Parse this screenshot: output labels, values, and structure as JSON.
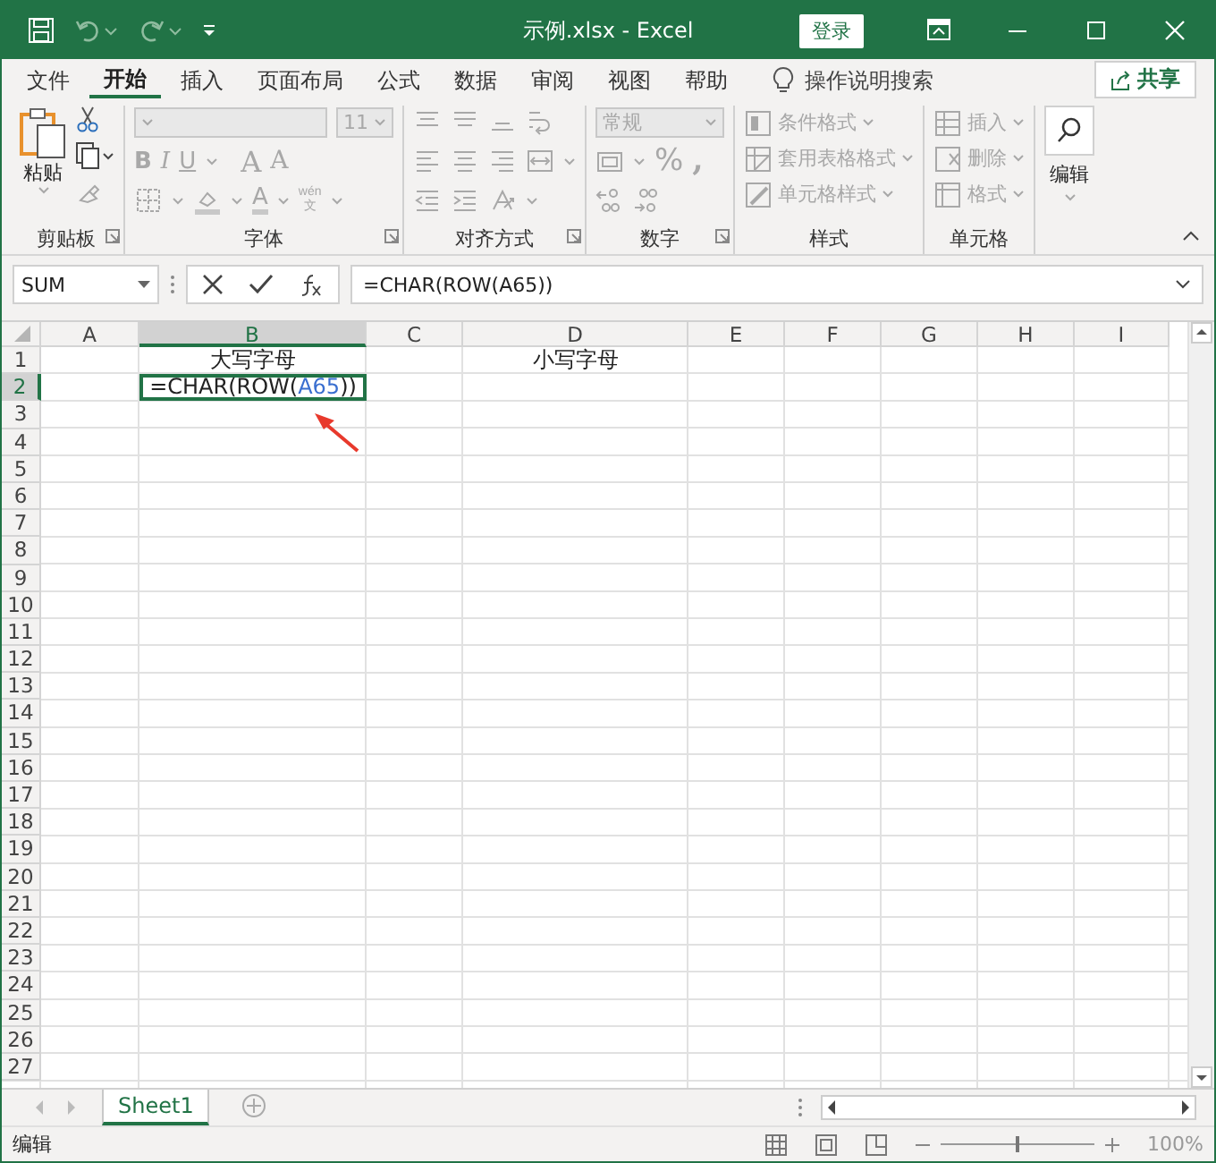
{
  "window": {
    "title": "示例.xlsx  -  Excel",
    "sign_in": "登录"
  },
  "menu_tabs": [
    {
      "label": "文件",
      "selected": false
    },
    {
      "label": "开始",
      "selected": true
    },
    {
      "label": "插入",
      "selected": false
    },
    {
      "label": "页面布局",
      "selected": false
    },
    {
      "label": "公式",
      "selected": false
    },
    {
      "label": "数据",
      "selected": false
    },
    {
      "label": "审阅",
      "selected": false
    },
    {
      "label": "视图",
      "selected": false
    },
    {
      "label": "帮助",
      "selected": false
    }
  ],
  "tell_me": "操作说明搜索",
  "share": "共享",
  "ribbon": {
    "groups": [
      {
        "kind": "clipboard",
        "label": "剪贴板",
        "disabled": false,
        "items": [
          "粘贴"
        ]
      },
      {
        "kind": "font",
        "label": "字体",
        "disabled": true,
        "items": [
          "11",
          "B",
          "I",
          "U",
          "A",
          "A",
          "A",
          "wén",
          "文"
        ]
      },
      {
        "kind": "alignment",
        "label": "对齐方式",
        "disabled": true
      },
      {
        "kind": "number",
        "label": "数字",
        "disabled": true,
        "items": [
          "常规",
          "%",
          ","
        ]
      },
      {
        "kind": "styles",
        "label": "样式",
        "disabled": true,
        "items": [
          "条件格式",
          "套用表格格式",
          "单元格样式"
        ]
      },
      {
        "kind": "cells",
        "label": "单元格",
        "disabled": true,
        "items": [
          "插入",
          "删除",
          "格式"
        ]
      },
      {
        "kind": "editing",
        "label": "编辑",
        "disabled": false
      }
    ]
  },
  "formula_bar": {
    "name_box": "SUM",
    "formula": "=CHAR(ROW(A65))"
  },
  "grid": {
    "columns": [
      {
        "label": "A",
        "selected": false
      },
      {
        "label": "B",
        "selected": true
      },
      {
        "label": "C",
        "selected": false
      },
      {
        "label": "D",
        "selected": false
      },
      {
        "label": "E",
        "selected": false
      },
      {
        "label": "F",
        "selected": false
      },
      {
        "label": "G",
        "selected": false
      },
      {
        "label": "H",
        "selected": false
      },
      {
        "label": "I",
        "selected": false
      }
    ],
    "rows": [
      {
        "label": "1",
        "selected": false,
        "cells": {
          "B": {
            "active": false,
            "segments": [
              {
                "text": "大写字母",
                "kind": "plain"
              }
            ]
          },
          "D": {
            "active": false,
            "segments": [
              {
                "text": "小写字母",
                "kind": "plain"
              }
            ]
          }
        }
      },
      {
        "label": "2",
        "selected": true,
        "cells": {
          "B": {
            "active": true,
            "segments": [
              {
                "text": "=CHAR(ROW(",
                "kind": "plain"
              },
              {
                "text": "A65",
                "kind": "reference"
              },
              {
                "text": "))",
                "kind": "plain"
              }
            ]
          }
        }
      },
      {
        "label": "3",
        "selected": false
      },
      {
        "label": "4",
        "selected": false
      },
      {
        "label": "5",
        "selected": false
      },
      {
        "label": "6",
        "selected": false
      },
      {
        "label": "7",
        "selected": false
      },
      {
        "label": "8",
        "selected": false
      },
      {
        "label": "9",
        "selected": false
      },
      {
        "label": "10",
        "selected": false
      },
      {
        "label": "11",
        "selected": false
      },
      {
        "label": "12",
        "selected": false
      },
      {
        "label": "13",
        "selected": false
      },
      {
        "label": "14",
        "selected": false
      },
      {
        "label": "15",
        "selected": false
      },
      {
        "label": "16",
        "selected": false
      },
      {
        "label": "17",
        "selected": false
      },
      {
        "label": "18",
        "selected": false
      },
      {
        "label": "19",
        "selected": false
      },
      {
        "label": "20",
        "selected": false
      },
      {
        "label": "21",
        "selected": false
      },
      {
        "label": "22",
        "selected": false
      },
      {
        "label": "23",
        "selected": false
      },
      {
        "label": "24",
        "selected": false
      },
      {
        "label": "25",
        "selected": false
      },
      {
        "label": "26",
        "selected": false
      },
      {
        "label": "27",
        "selected": false
      }
    ]
  },
  "sheets": [
    {
      "name": "Sheet1",
      "selected": true
    }
  ],
  "status_bar": {
    "mode": "编辑",
    "zoom": "100%",
    "zoom_slider": {
      "level": 0.5
    }
  }
}
